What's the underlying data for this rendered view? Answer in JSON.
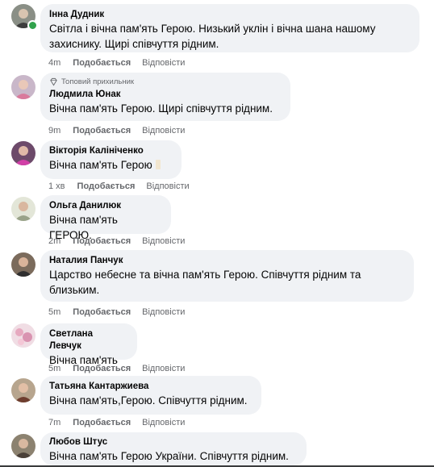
{
  "colors": {
    "bubble": "#f0f2f5",
    "meta": "#65676b",
    "online": "#31a24c"
  },
  "badge": {
    "icon": "diamond-icon",
    "label": "Топовий прихильник"
  },
  "comments": [
    {
      "author": "Інна Дудник",
      "text_lines": [
        "Світла і вічна пам'ять Герою. Низький уклін і вічна шана нашому",
        "захиснику. Щирі співчуття рідним."
      ],
      "time": "4m",
      "like": "Подобається",
      "reply": "Відповісти"
    },
    {
      "author": "Людмила Юнак",
      "text_lines": [
        "Вічна пам'ять Герою. Щирі співчуття рідним."
      ],
      "time": "9m",
      "like": "Подобається",
      "reply": "Відповісти"
    },
    {
      "author": "Вікторія Калініченко",
      "text_lines": [
        "Вічна пам'ять Герою"
      ],
      "time": "1 хв",
      "like": "Подобається",
      "reply": "Відповісти"
    },
    {
      "author": "Ольга Данилюк",
      "text_lines": [
        "Вічна пам'ять ГЕРОЮ."
      ],
      "time": "2m",
      "like": "Подобається",
      "reply": "Відповісти"
    },
    {
      "author": "Наталия Панчук",
      "text_lines": [
        "Царство небесне та вічна пам'ять Герою. Співчуття рідним та",
        "близьким."
      ],
      "time": "5m",
      "like": "Подобається",
      "reply": "Відповісти"
    },
    {
      "author": "Светлана Левчук",
      "text_lines": [
        "Вічна пам'ять"
      ],
      "time": "5m",
      "like": "Подобається",
      "reply": "Відповісти"
    },
    {
      "author": "Татьяна Кантаржиева",
      "text_lines": [
        "Вічна пам'ять,Герою. Співчуття рідним."
      ],
      "time": "7m",
      "like": "Подобається",
      "reply": "Відповісти"
    },
    {
      "author": "Любов Штус",
      "text_lines": [
        "Вічна пам'ять Герою України. Співчуття рідним."
      ]
    }
  ]
}
